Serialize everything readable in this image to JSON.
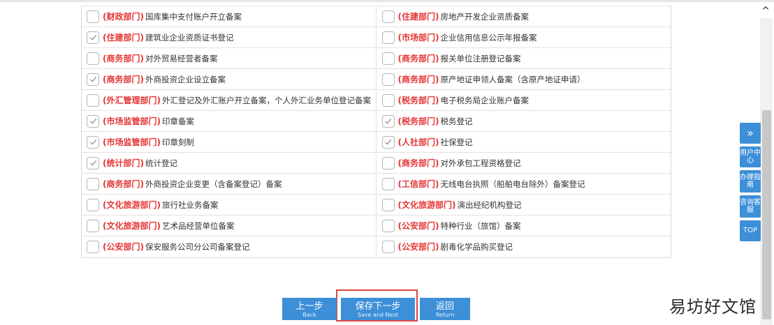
{
  "rows": [
    {
      "left": {
        "checked": false,
        "tag": "(财政部门)",
        "label": "国库集中支付账户开立备案"
      },
      "right": {
        "checked": false,
        "tag": "(住建部门)",
        "label": "房地产开发企业资质备案"
      }
    },
    {
      "left": {
        "checked": true,
        "tag": "(住建部门)",
        "label": "建筑业企业资质证书登记"
      },
      "right": {
        "checked": false,
        "tag": "(市场部门)",
        "label": "企业信用信息公示年报备案"
      }
    },
    {
      "left": {
        "checked": false,
        "tag": "(商务部门)",
        "label": "对外贸易经营者备案"
      },
      "right": {
        "checked": false,
        "tag": "(商务部门)",
        "label": "报关单位注册登记备案"
      }
    },
    {
      "left": {
        "checked": true,
        "tag": "(商务部门)",
        "label": "外商投资企业设立备案"
      },
      "right": {
        "checked": false,
        "tag": "(商务部门)",
        "label": "原产地证申领人备案（含原产地证申请）"
      }
    },
    {
      "left": {
        "checked": false,
        "tag": "(外汇管理部门)",
        "label": "外汇登记及外汇账户开立备案，个人外汇业务单位登记备案"
      },
      "right": {
        "checked": false,
        "tag": "(税务部门)",
        "label": "电子税务局企业账户备案"
      }
    },
    {
      "left": {
        "checked": true,
        "tag": "(市场监管部门)",
        "label": "印章备案"
      },
      "right": {
        "checked": true,
        "tag": "(税务部门)",
        "label": "税务登记"
      }
    },
    {
      "left": {
        "checked": true,
        "tag": "(市场监管部门)",
        "label": "印章刻制"
      },
      "right": {
        "checked": true,
        "tag": "(人社部门)",
        "label": "社保登记"
      }
    },
    {
      "left": {
        "checked": true,
        "tag": "(统计部门)",
        "label": "统计登记"
      },
      "right": {
        "checked": false,
        "tag": "(商务部门)",
        "label": "对外承包工程资格登记"
      }
    },
    {
      "left": {
        "checked": false,
        "tag": "(商务部门)",
        "label": "外商投资企业变更（含备案登记）备案"
      },
      "right": {
        "checked": false,
        "tag": "(工信部门)",
        "label": "无线电台执照（船舶电台除外）备案登记"
      }
    },
    {
      "left": {
        "checked": false,
        "tag": "(文化旅游部门)",
        "label": "旅行社业务备案"
      },
      "right": {
        "checked": false,
        "tag": "(文化旅游部门)",
        "label": "演出经纪机构登记"
      }
    },
    {
      "left": {
        "checked": false,
        "tag": "(文化旅游部门)",
        "label": "艺术品经营单位备案"
      },
      "right": {
        "checked": false,
        "tag": "(公安部门)",
        "label": "特种行业（旅馆）备案"
      }
    },
    {
      "left": {
        "checked": false,
        "tag": "(公安部门)",
        "label": "保安服务公司分公司备案登记"
      },
      "right": {
        "checked": false,
        "tag": "(公安部门)",
        "label": "剧毒化学品购买登记"
      }
    }
  ],
  "buttons": {
    "back": {
      "label": "上一步",
      "sub": "Back"
    },
    "next": {
      "label": "保存下一步",
      "sub": "Save and Next"
    },
    "return": {
      "label": "返回",
      "sub": "Return"
    }
  },
  "sidebar": {
    "expand_icon": "»",
    "item1": "用户中心",
    "item2": "办理指南",
    "item3": "咨询客服",
    "top": "TOP"
  },
  "scroll_up_icon": "^",
  "watermark": "易坊好文馆",
  "colors": {
    "accent": "#3d8fd8",
    "tag_red": "#e53535",
    "highlight_border": "#e0463f"
  }
}
